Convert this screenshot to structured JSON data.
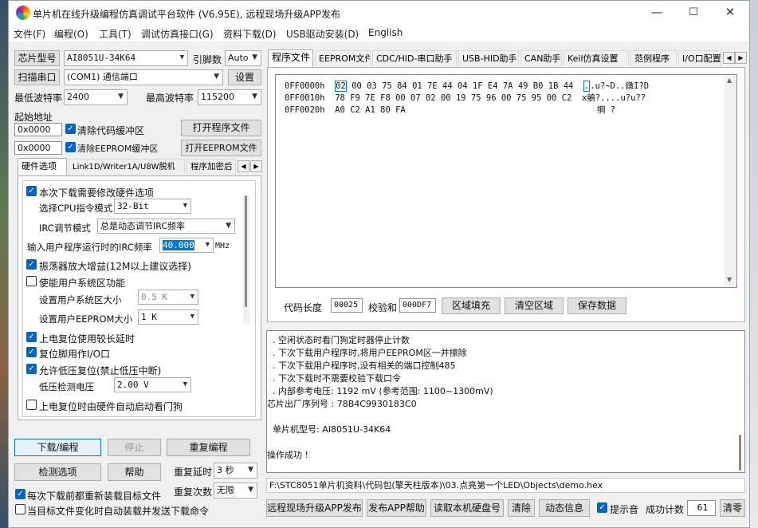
{
  "window": {
    "title": "单片机在线升级编程仿真调试平台软件 (V6.95E), 远程现场升级APP发布",
    "min": "—",
    "max": "☐",
    "close": "✕"
  },
  "menu": [
    "文件(F)",
    "编程(O)",
    "工具(T)",
    "调试仿真接口(G)",
    "资料下载(D)",
    "USB驱动安装(D)",
    "English"
  ],
  "left": {
    "chip_btn": "芯片型号",
    "chip_value": "AI8051U-34K64",
    "pins_label": "引脚数",
    "pins_value": "Auto",
    "scan_btn": "扫描串口",
    "port_value": "(COM1) 通信端口",
    "settings_btn": "设置",
    "min_baud_label": "最低波特率",
    "min_baud_value": "2400",
    "max_baud_label": "最高波特率",
    "max_baud_value": "115200",
    "start_addr_label": "起始地址",
    "addr1": "0x0000",
    "clear_code": "清除代码缓冲区",
    "open_prog_btn": "打开程序文件",
    "addr2": "0x0000",
    "clear_eeprom": "清除EEPROM缓冲区",
    "open_eeprom_btn": "打开EEPROM文件",
    "tabs": [
      "硬件选项",
      "Link1D/Writer1A/U8W脱机",
      "程序加密后"
    ],
    "hw": {
      "opt_modify": "本次下载需要修改硬件选项",
      "cpu_label": "选择CPU指令模式",
      "cpu_value": "32-Bit",
      "irc_label": "IRC调节模式",
      "irc_value": "总是动态调节IRC频率",
      "freq_label": "输入用户程序运行时的IRC频率",
      "freq_value": "40.000",
      "freq_unit": "MHz",
      "osc_gain": "振荡器放大增益(12M以上建议选择)",
      "sys_area": "使能用户系统区功能",
      "sys_size_label": "设置用户系统区大小",
      "sys_size_value": "0.5 K",
      "eeprom_size_label": "设置用户EEPROM大小",
      "eeprom_size_value": "1   K",
      "por_long": "上电复位使用较长延时",
      "reset_io": "复位脚用作I/O口",
      "lvr": "允许低压复位(禁止低压中断)",
      "lvd_label": "低压检测电压",
      "lvd_value": "2.00 V",
      "wdt": "上电复位时由硬件自动启动看门狗"
    },
    "download_btn": "下载/编程",
    "stop_btn": "停止",
    "redo_btn": "重复编程",
    "detect_btn": "检测选项",
    "help_btn": "帮助",
    "repeat_delay_label": "重复延时",
    "repeat_delay_value": "3 秒",
    "repeat_count_label": "重复次数",
    "repeat_count_value": "无限",
    "reload_each": "每次下载前都重新装载目标文件",
    "auto_send": "当目标文件变化时自动装载并发送下载命令"
  },
  "right": {
    "tabs": [
      "程序文件",
      "EEPROM文件",
      "CDC/HID-串口助手",
      "USB-HID助手",
      "CAN助手",
      "Keil仿真设置",
      "范例程序",
      "I/O口配置"
    ],
    "hex_rows": [
      {
        "addr": "0FF0000h",
        "sel": "02",
        "bytes": "00 03 75 84 01 7E 44 04 1F E4 7A 49 B0 1B 44",
        "ascii_sel": ".",
        "ascii": ".u?~D..鐓I?D"
      },
      {
        "addr": "0FF0010h",
        "sel": "",
        "bytes": "78 F9 7E F8 00 07 02 00 19 75 96 00 75 95 00 C2",
        "ascii_sel": "",
        "ascii": "x鵢?....u?u??"
      },
      {
        "addr": "0FF0020h",
        "sel": "",
        "bytes": "A0 C2 A1 80 FA",
        "ascii_sel": "",
        "ascii": "犅 ?"
      }
    ],
    "code_len_label": "代码长度",
    "code_len_value": "00025",
    "checksum_label": "校验和",
    "checksum_value": "000DF7",
    "fill_btn": "区域填充",
    "clear_btn": "清空区域",
    "save_btn": "保存数据",
    "log": [
      "  . 空闲状态时看门狗定时器停止计数",
      "  . 下次下载用户程序时,将用户EEPROM区一并擦除",
      "  . 下次下载用户程序时,没有相关的端口控制485",
      "  . 下次下载时不需要校验下载口令",
      "  . 内部参考电压: 1192 mV (参考范围: 1100~1300mV)",
      "芯片出厂序列号 : 78B4C9930183C0",
      "",
      "  单片机型号: AI8051U-34K64",
      "",
      "操作成功 !"
    ],
    "path": "F:\\STC8051单片机资料\\代码包(擎天柱版本)\\03.点亮第一个LED\\Objects\\demo.hex",
    "bottom": {
      "remote_btn": "远程现场升级APP发布",
      "publish_btn": "发布APP帮助",
      "read_hd_btn": "读取本机硬盘号",
      "clear_btn": "清除",
      "anim_btn": "动态信息",
      "beep_label": "提示音",
      "success_label": "成功计数",
      "success_value": "61",
      "reset_btn": "清零"
    }
  }
}
